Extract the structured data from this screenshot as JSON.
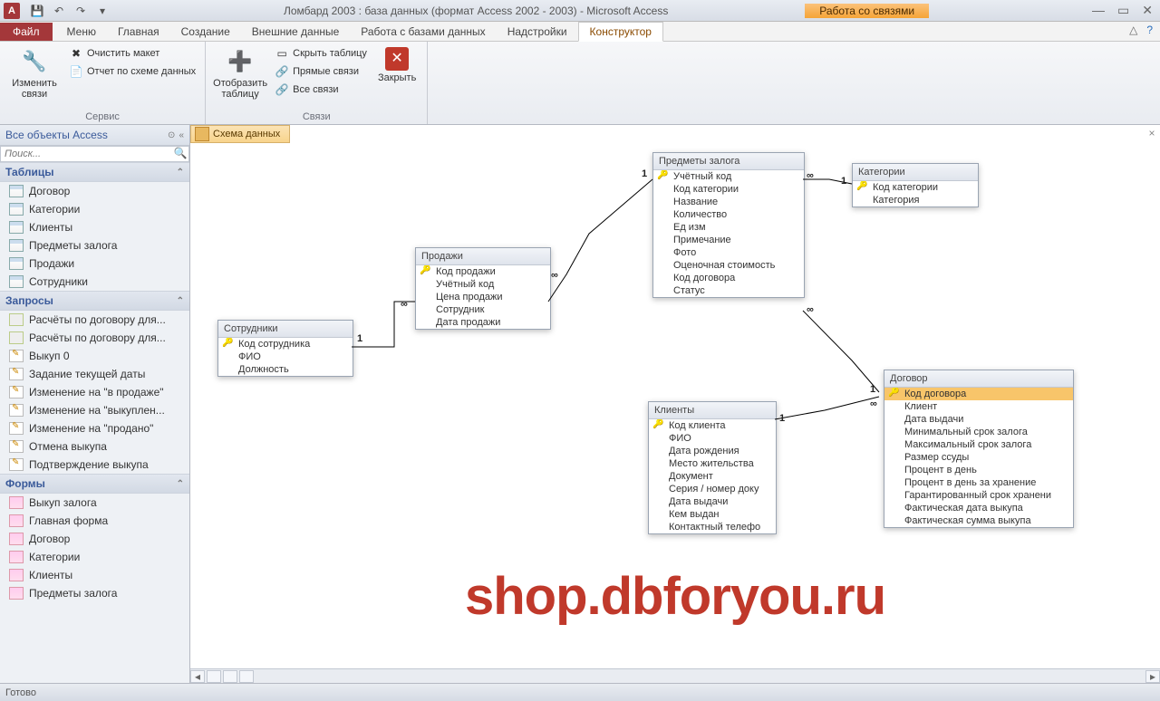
{
  "titlebar": {
    "app_letter": "A",
    "title": "Ломбард 2003 : база данных (формат Access 2002 - 2003)  -  Microsoft Access",
    "contextual": "Работа со связями"
  },
  "tabs": {
    "file": "Файл",
    "items": [
      "Меню",
      "Главная",
      "Создание",
      "Внешние данные",
      "Работа с базами данных",
      "Надстройки"
    ],
    "context": "Конструктор"
  },
  "ribbon": {
    "g1": {
      "label": "Сервис",
      "edit_rel": "Изменить связи",
      "clear": "Очистить макет",
      "report": "Отчет по схеме данных"
    },
    "g2": {
      "label": "Связи",
      "show_table": "Отобразить таблицу",
      "hide_table": "Скрыть таблицу",
      "direct": "Прямые связи",
      "all": "Все связи",
      "close": "Закрыть"
    }
  },
  "nav": {
    "header": "Все объекты Access",
    "search_ph": "Поиск...",
    "groups": {
      "tables": "Таблицы",
      "queries": "Запросы",
      "forms": "Формы"
    },
    "tables": [
      "Договор",
      "Категории",
      "Клиенты",
      "Предметы залога",
      "Продажи",
      "Сотрудники"
    ],
    "queries": [
      "Расчёты по договору для...",
      "Расчёты по договору для...",
      "Выкуп 0",
      "Задание текущей даты",
      "Изменение на \"в продаже\"",
      "Изменение на \"выкуплен...",
      "Изменение на \"продано\"",
      "Отмена выкупа",
      "Подтверждение выкупа"
    ],
    "forms": [
      "Выкуп залога",
      "Главная форма",
      "Договор",
      "Категории",
      "Клиенты",
      "Предметы залога"
    ]
  },
  "doc_tab": "Схема данных",
  "tables": {
    "predmety": {
      "title": "Предметы залога",
      "fields": [
        "Учётный код",
        "Код категории",
        "Название",
        "Количество",
        "Ед изм",
        "Примечание",
        "Фото",
        "Оценочная стоимость",
        "Код договора",
        "Статус"
      ],
      "pk": [
        0
      ]
    },
    "kategorii": {
      "title": "Категории",
      "fields": [
        "Код категории",
        "Категория"
      ],
      "pk": [
        0
      ]
    },
    "prodazhi": {
      "title": "Продажи",
      "fields": [
        "Код продажи",
        "Учётный код",
        "Цена продажи",
        "Сотрудник",
        "Дата продажи"
      ],
      "pk": [
        0
      ]
    },
    "sotrudniki": {
      "title": "Сотрудники",
      "fields": [
        "Код сотрудника",
        "ФИО",
        "Должность"
      ],
      "pk": [
        0
      ]
    },
    "klienty": {
      "title": "Клиенты",
      "fields": [
        "Код клиента",
        "ФИО",
        "Дата рождения",
        "Место жительства",
        "Документ",
        "Серия / номер доку",
        "Дата выдачи",
        "Кем выдан",
        "Контактный телефо"
      ],
      "pk": [
        0
      ]
    },
    "dogovor": {
      "title": "Договор",
      "fields": [
        "Код договора",
        "Клиент",
        "Дата выдачи",
        "Минимальный срок залога",
        "Максимальный срок залога",
        "Размер ссуды",
        "Процент в день",
        "Процент в день за хранение",
        "Гарантированный срок хранени",
        "Фактическая дата выкупа",
        "Фактическая сумма выкупа"
      ],
      "pk": [
        0
      ],
      "selected": 0
    }
  },
  "rels": {
    "one": "1",
    "inf": "∞"
  },
  "watermark": "shop.dbforyou.ru",
  "status": "Готово"
}
